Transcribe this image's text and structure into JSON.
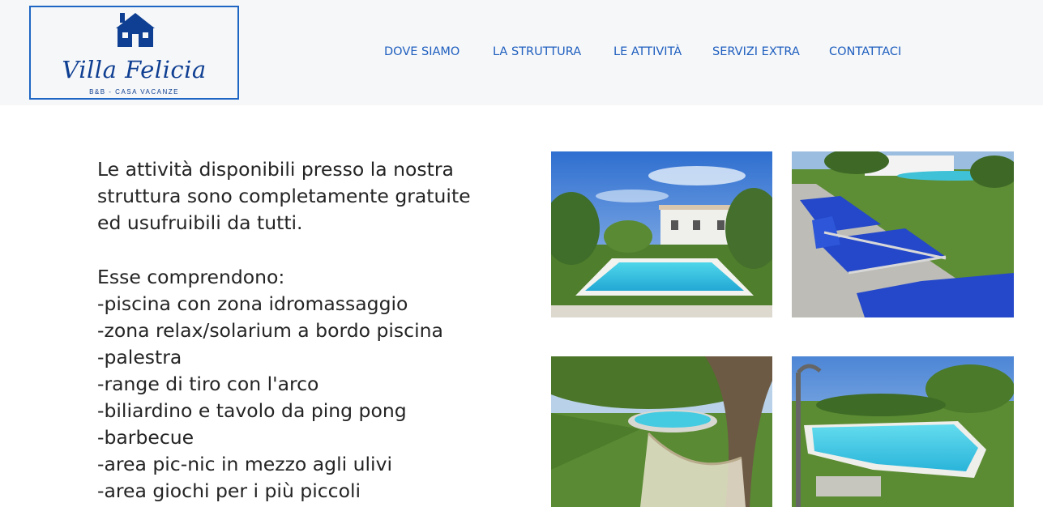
{
  "brand": {
    "name": "Villa Felicia",
    "tagline": "B&B - CASA VACANZE",
    "color": "#0f3f92",
    "border_color": "#1f66c4",
    "icon": "house-icon"
  },
  "nav": {
    "items": [
      {
        "label": "DOVE SIAMO"
      },
      {
        "label": "LA STRUTTURA"
      },
      {
        "label": "LE ATTIVITÀ"
      },
      {
        "label": "SERVIZI EXTRA"
      },
      {
        "label": "CONTATTACI"
      }
    ],
    "color": "#1f5fbf"
  },
  "content": {
    "intro_lines": [
      "Le attività disponibili presso la nostra",
      "struttura sono completamente gratuite",
      "ed usufruibili da tutti."
    ],
    "heading": "Esse comprendono:",
    "activities": [
      "-piscina con zona idromassaggio",
      "-zona relax/solarium a bordo piscina",
      "-palestra",
      "-range di tiro con l'arco",
      "-biliardino e tavolo da ping pong",
      "-barbecue",
      "-area pic-nic in mezzo agli ulivi",
      "-area giochi per i più piccoli"
    ]
  },
  "gallery": {
    "photos": [
      {
        "subject": "pool-with-villa"
      },
      {
        "subject": "sun-loungers-by-pool"
      },
      {
        "subject": "hammock-under-olive-tree"
      },
      {
        "subject": "pool-with-outdoor-shower"
      }
    ]
  }
}
